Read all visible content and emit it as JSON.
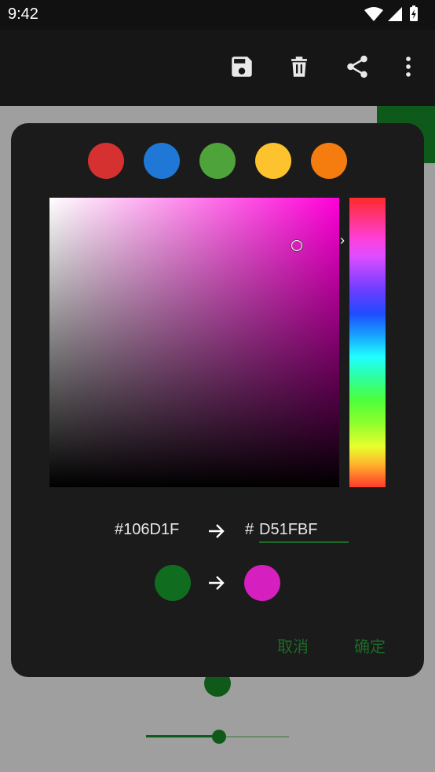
{
  "status_bar": {
    "time": "9:42"
  },
  "toolbar": {
    "icons": [
      "save-icon",
      "delete-icon",
      "share-icon",
      "more-vert-icon"
    ]
  },
  "dialog": {
    "presets": [
      {
        "name": "red",
        "color": "#d63131"
      },
      {
        "name": "blue",
        "color": "#1f78d6"
      },
      {
        "name": "green",
        "color": "#4fa33b"
      },
      {
        "name": "yellow",
        "color": "#fdc32f"
      },
      {
        "name": "orange",
        "color": "#f57c0e"
      }
    ],
    "picker": {
      "hue_color": "#ff00d8"
    },
    "old_hex": "#106D1F",
    "hex_prefix": "#",
    "new_hex_value": "D51FBF",
    "old_color": "#106D1F",
    "new_color": "#D51FBF",
    "cancel_label": "取消",
    "ok_label": "确定"
  },
  "background": {
    "slider_fraction": 0.51
  }
}
